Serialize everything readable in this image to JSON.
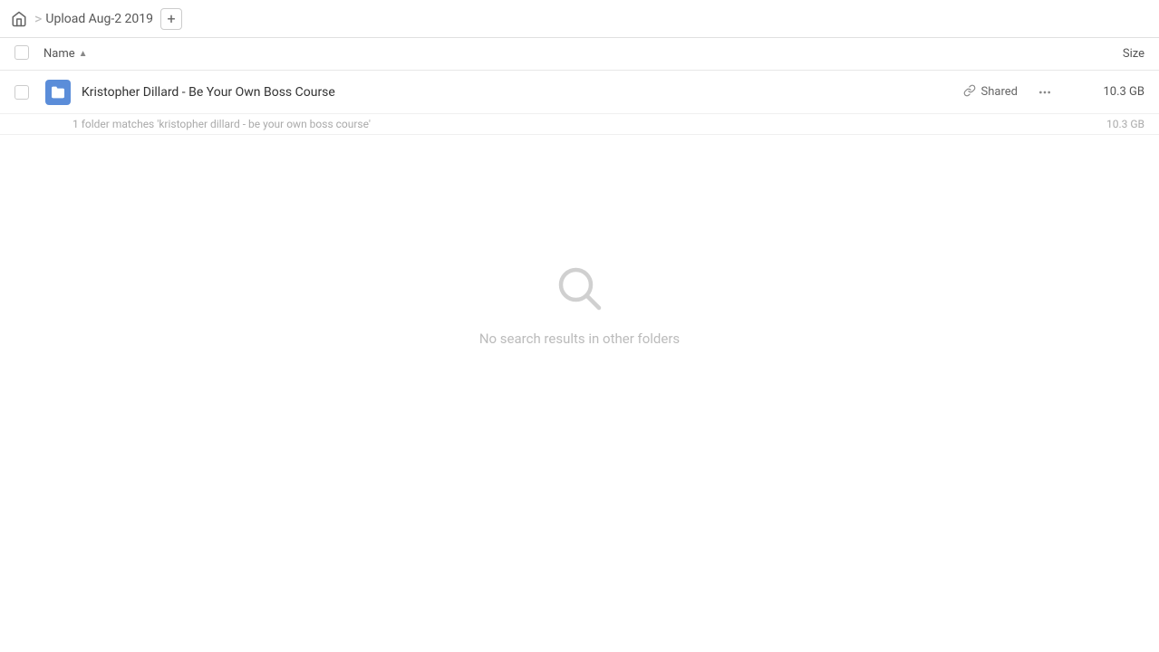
{
  "topbar": {
    "home_icon": "home",
    "breadcrumb_separator": ">",
    "breadcrumb_item": "Upload Aug-2 2019",
    "add_tab_icon": "+"
  },
  "column_header": {
    "checkbox_label": "checkbox",
    "name_label": "Name",
    "sort_arrow": "▲",
    "size_label": "Size"
  },
  "file_row": {
    "name": "Kristopher Dillard - Be Your Own Boss Course",
    "shared_label": "Shared",
    "size": "10.3 GB",
    "more_icon": "···",
    "link_icon": "🔗"
  },
  "match_info": {
    "text": "1 folder matches 'kristopher dillard - be your own boss course'",
    "size": "10.3 GB"
  },
  "empty_state": {
    "icon": "search",
    "message": "No search results in other folders"
  }
}
